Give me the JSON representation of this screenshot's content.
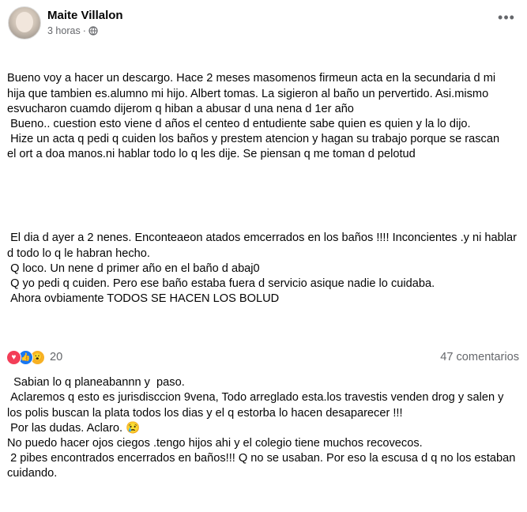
{
  "post": {
    "author": "Maite Villalon",
    "time": "3 horas",
    "separator": "·",
    "paragraphs": [
      "Bueno voy a hacer un descargo. Hace 2 meses masomenos firmeun acta en la secundaria d mi\nhija que tambien es.alumno mi hijo. Albert tomas. La sigieron al baño un pervertido. Asi.mismo\nesvucharon cuamdo dijerom q hiban a abusar d una nena d 1er año\n Bueno.. cuestion esto viene d años el centeo d entudiente sabe quien es quien y la lo dijo.\n Hize un acta q pedi q cuiden los baños y prestem atencion y hagan su trabajo porque se rascan\nel ort a doa manos.ni hablar todo lo q les dije. Se piensan q me toman d pelotud",
      " El dia d ayer a 2 nenes. Enconteaeon atados emcerrados en los baños !!!! Inconcientes .y ni hablar\nd todo lo q le habran hecho.\n Q loco. Un nene d primer año en el baño d abaj0\n Q yo pedi q cuiden. Pero ese baño estaba fuera d servicio asique nadie lo cuidaba.\n Ahora ovbiamente TODOS SE HACEN LOS BOLUD",
      "  Sabian lo q planeabannn y  paso.\n Aclaremos q esto es jurisdisccion 9vena, Todo arreglado esta.los travestis venden drog y salen y\nlos polis buscan la plata todos los dias y el q estorba lo hacen desaparecer !!!\n Por las dudas. Aclaro. 😢\nNo puedo hacer ojos ciegos .tengo hijos ahi y el colegio tiene muchos recovecos.\n 2 pibes encontrados encerrados en baños!!! Q no se usaban. Por eso la escusa d q no los estaban\ncuidando."
    ]
  },
  "footer": {
    "reaction_count": "20",
    "comments": "47 comentarios"
  },
  "icons": {
    "more": "more-horizontal-icon",
    "privacy": "friends-globe-icon",
    "reactions": [
      "love-reaction-icon",
      "like-reaction-icon",
      "wow-reaction-icon"
    ]
  }
}
